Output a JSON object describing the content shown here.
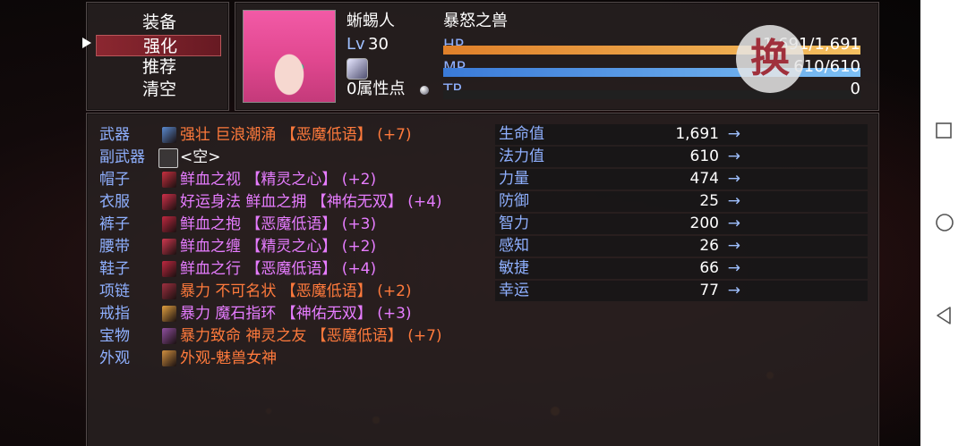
{
  "menu": {
    "items": [
      "装备",
      "强化",
      "推荐",
      "清空"
    ],
    "selected_index": 1
  },
  "actor": {
    "name": "蜥蜴人",
    "class": "暴怒之兽",
    "level_label": "Lv",
    "level": "30",
    "points_text": "0属性点",
    "hp_label": "HP",
    "hp_value": "1,691/1,691",
    "hp_ratio": 1.0,
    "mp_label": "MP",
    "mp_value": "610/610",
    "mp_ratio": 1.0,
    "tp_label": "TP",
    "tp_value": "0",
    "tp_ratio": 0.0,
    "stamp_char": "换"
  },
  "equipment": [
    {
      "slot": "武器",
      "text": "强壮 巨浪潮涌 【恶魔低语】 (+7)",
      "color": "#ff7a3c",
      "icon": "trident-icon",
      "icon_color": "#5a8ad0"
    },
    {
      "slot": "副武器",
      "text": "<空>",
      "color": "#ffffff",
      "icon": "empty-slot-icon",
      "icon_color": ""
    },
    {
      "slot": "帽子",
      "text": "鲜血之视 【精灵之心】 (+2)",
      "color": "#e67cff",
      "icon": "helmet-icon",
      "icon_color": "#c83040"
    },
    {
      "slot": "衣服",
      "text": "好运身法 鲜血之拥 【神佑无双】 (+4)",
      "color": "#e67cff",
      "icon": "armor-icon",
      "icon_color": "#d0304a"
    },
    {
      "slot": "裤子",
      "text": "鲜血之抱 【恶魔低语】 (+3)",
      "color": "#e67cff",
      "icon": "pants-icon",
      "icon_color": "#c02840"
    },
    {
      "slot": "腰带",
      "text": "鲜血之缠 【精灵之心】 (+2)",
      "color": "#e67cff",
      "icon": "belt-icon",
      "icon_color": "#d03850"
    },
    {
      "slot": "鞋子",
      "text": "鲜血之行 【恶魔低语】 (+4)",
      "color": "#e67cff",
      "icon": "boots-icon",
      "icon_color": "#c02840"
    },
    {
      "slot": "项链",
      "text": "暴力 不可名状 【恶魔低语】 (+2)",
      "color": "#ff7a3c",
      "icon": "necklace-icon",
      "icon_color": "#a03040"
    },
    {
      "slot": "戒指",
      "text": "暴力 魔石指环 【神佑无双】 (+3)",
      "color": "#e67cff",
      "icon": "ring-icon",
      "icon_color": "#e0a040"
    },
    {
      "slot": "宝物",
      "text": "暴力致命 神灵之友 【恶魔低语】 (+7)",
      "color": "#ff7a3c",
      "icon": "treasure-icon",
      "icon_color": "#9050a0"
    },
    {
      "slot": "外观",
      "text": "外观-魅兽女神",
      "color": "#ff7a3c",
      "icon": "costume-icon",
      "icon_color": "#d09040"
    }
  ],
  "params": [
    {
      "name": "生命值",
      "value": "1,691",
      "arrow": "→"
    },
    {
      "name": "法力值",
      "value": "610",
      "arrow": "→"
    },
    {
      "name": "力量",
      "value": "474",
      "arrow": "→"
    },
    {
      "name": "防御",
      "value": "25",
      "arrow": "→"
    },
    {
      "name": "智力",
      "value": "200",
      "arrow": "→"
    },
    {
      "name": "感知",
      "value": "26",
      "arrow": "→"
    },
    {
      "name": "敏捷",
      "value": "66",
      "arrow": "→"
    },
    {
      "name": "幸运",
      "value": "77",
      "arrow": "→"
    }
  ]
}
